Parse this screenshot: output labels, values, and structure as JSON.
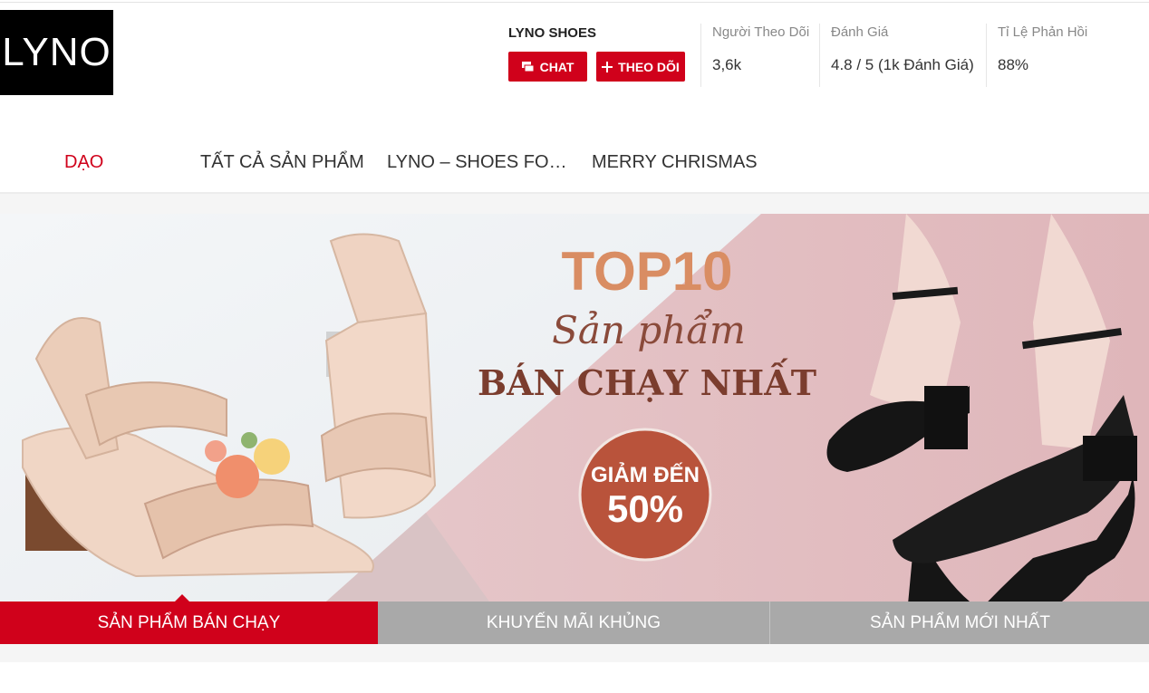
{
  "shop": {
    "logo_text": "LYNO",
    "name": "LYNO SHOES",
    "chat_label": "CHAT",
    "follow_label": "THEO DÕI"
  },
  "stats": [
    {
      "label": "Người Theo Dõi",
      "value": "3,6k"
    },
    {
      "label": "Đánh Giá",
      "value": "4.8 / 5 (1k Đánh Giá)"
    },
    {
      "label": "Tỉ Lệ Phản Hồi",
      "value": "88%"
    }
  ],
  "nav": [
    {
      "label": "DẠO",
      "active": true
    },
    {
      "label": "TẤT CẢ SẢN PHẨM",
      "active": false
    },
    {
      "label": "LYNO – SHOES FO…",
      "active": false
    },
    {
      "label": "MERRY CHRISMAS",
      "active": false
    }
  ],
  "banner": {
    "headline": "TOP10",
    "script_line": "Sản phẩm",
    "subline": "BÁN CHẠY NHẤT",
    "discount_line1": "GIẢM ĐẾN",
    "discount_line2": "50%"
  },
  "tabs": [
    {
      "label": "SẢN PHẨM BÁN CHẠY",
      "active": true
    },
    {
      "label": "KHUYẾN MÃI KHỦNG",
      "active": false
    },
    {
      "label": "SẢN PHẨM MỚI NHẤT",
      "active": false
    }
  ],
  "colors": {
    "brand_red": "#d0011b",
    "tab_gray": "#a9a9a9",
    "banner_pink": "#e7c6c8",
    "headline_orange": "#d98d63",
    "subline_brown": "#8a4a3a"
  }
}
